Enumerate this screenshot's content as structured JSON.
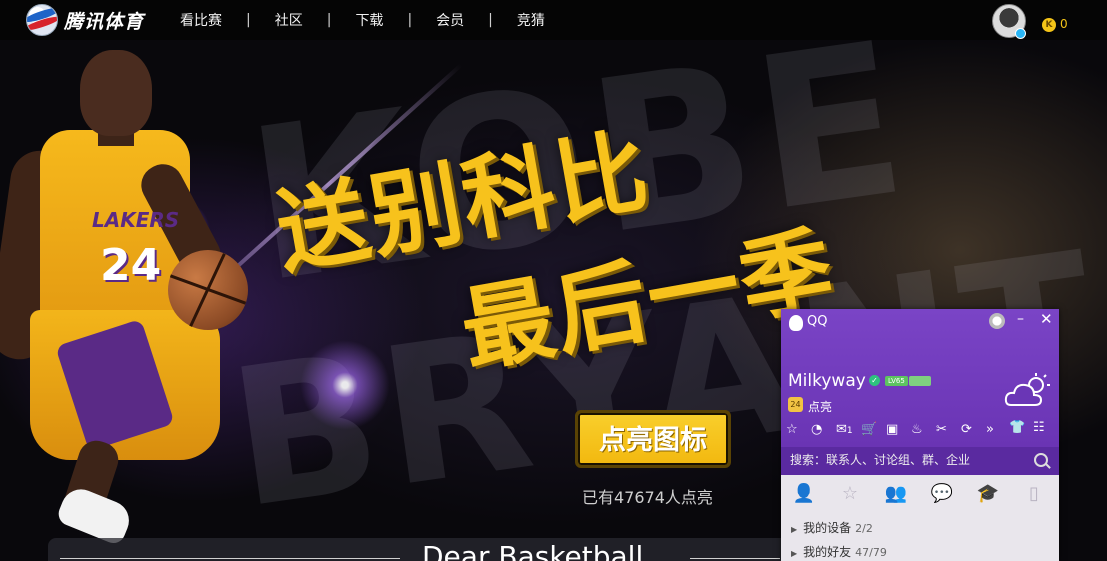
{
  "header": {
    "logo_text": "腾讯体育",
    "nav": [
      {
        "label": "看比赛"
      },
      {
        "label": "社区"
      },
      {
        "label": "下载"
      },
      {
        "label": "会员"
      },
      {
        "label": "竞猜"
      }
    ],
    "separator": "|",
    "coin_icon_text": "K",
    "coin_count": "0"
  },
  "hero": {
    "ghost_line1": "KOBE",
    "ghost_line2": "BRYANT",
    "jersey_team": "LAKERS",
    "jersey_number": "24",
    "headline_line1": "送别科比",
    "headline_line2": "最后一季",
    "light_button": "点亮图标",
    "light_count": "已有47674人点亮",
    "letter_title": "Dear Basketball"
  },
  "qq": {
    "title": "QQ",
    "minimize": "–",
    "close": "✕",
    "nickname": "Milkyway",
    "vip_badge": "LV65",
    "status_icon_text": "24",
    "status_text": "点亮",
    "toolbar": [
      {
        "icon": "☆"
      },
      {
        "icon": "◔"
      },
      {
        "icon": "✉",
        "badge": "1"
      },
      {
        "icon": "🛒"
      },
      {
        "icon": "▣"
      },
      {
        "icon": "♨"
      },
      {
        "icon": "✂"
      },
      {
        "icon": "⟳"
      },
      {
        "icon": "»"
      }
    ],
    "toolbar_right": [
      {
        "icon": "👕"
      },
      {
        "icon": "☷"
      }
    ],
    "search_placeholder": "搜索：联系人、讨论组、群、企业",
    "tabs": [
      {
        "icon": "👤"
      },
      {
        "icon": "☆"
      },
      {
        "icon": "👥"
      },
      {
        "icon": "💬"
      },
      {
        "icon": "🎓"
      },
      {
        "icon": "▯"
      }
    ],
    "groups": [
      {
        "name": "我的设备",
        "count": "2/2"
      },
      {
        "name": "我的好友",
        "count": "47/79"
      }
    ]
  },
  "colors": {
    "accent_gold": "#f7c21c",
    "qq_purple": "#6a36b6"
  }
}
